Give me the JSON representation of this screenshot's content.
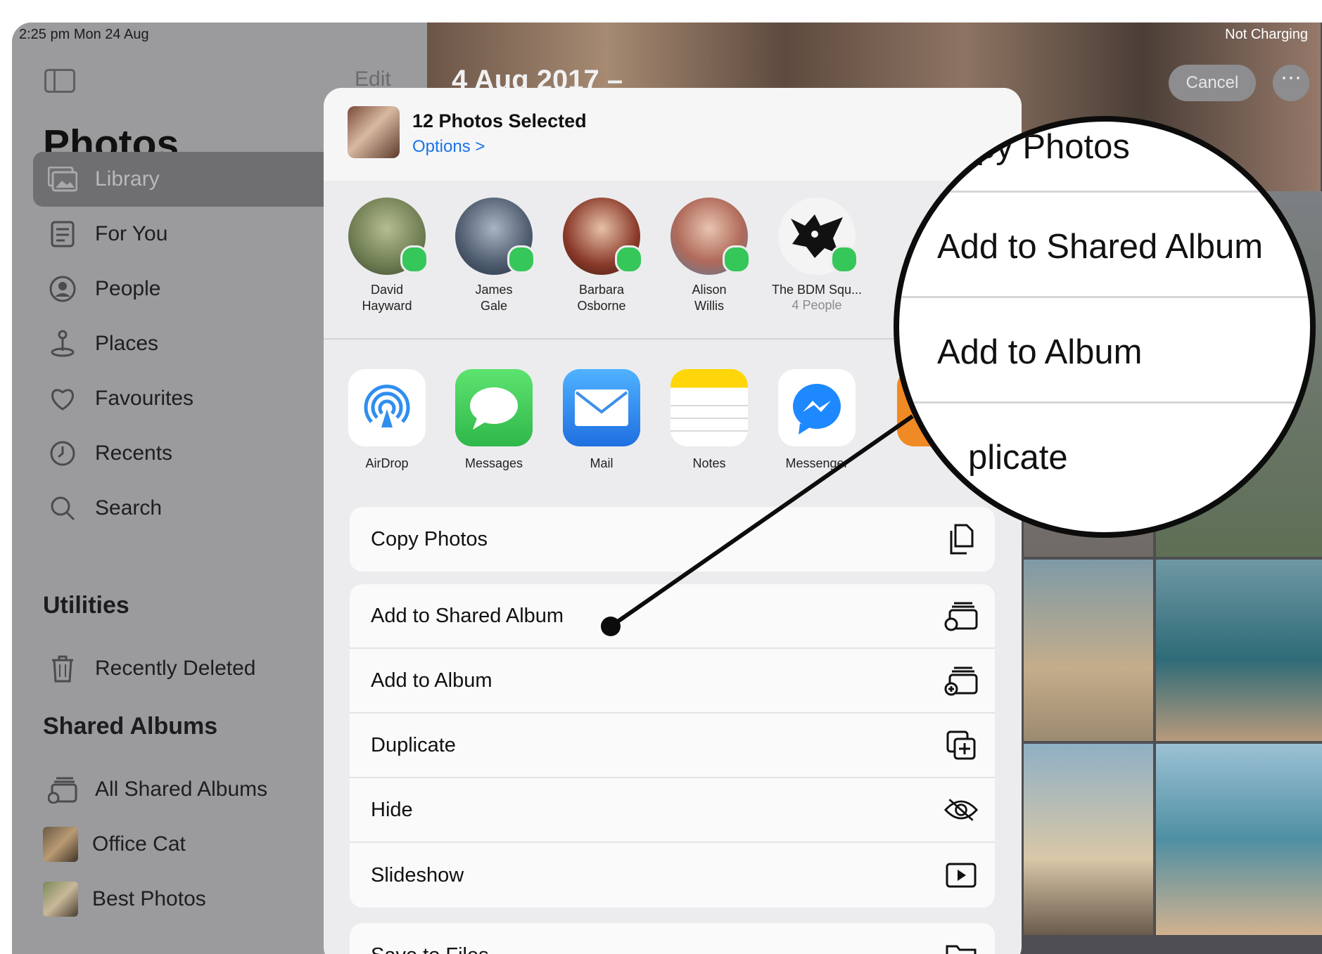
{
  "status": {
    "time": "2:25 pm  Mon 24 Aug",
    "right": "Not Charging"
  },
  "sidebar": {
    "edit_label": "Edit",
    "title": "Photos",
    "items": [
      {
        "label": "Library",
        "icon": "library-icon"
      },
      {
        "label": "For You",
        "icon": "for-you-icon"
      },
      {
        "label": "People",
        "icon": "people-icon"
      },
      {
        "label": "Places",
        "icon": "places-icon"
      },
      {
        "label": "Favourites",
        "icon": "heart-icon"
      },
      {
        "label": "Recents",
        "icon": "clock-icon"
      },
      {
        "label": "Search",
        "icon": "search-icon"
      }
    ],
    "utilities_heading": "Utilities",
    "utilities": [
      {
        "label": "Recently Deleted",
        "icon": "trash-icon"
      }
    ],
    "shared_heading": "Shared Albums",
    "shared": [
      {
        "label": "All Shared Albums",
        "icon": "shared-album-icon"
      },
      {
        "label": "Office Cat",
        "icon": "album-thumbnail"
      },
      {
        "label": "Best Photos",
        "icon": "album-thumbnail"
      }
    ]
  },
  "grid": {
    "date": "4 Aug 2017 –",
    "cancel_label": "Cancel",
    "more_label": "···"
  },
  "sheet": {
    "title": "12 Photos Selected",
    "options": "Options >",
    "contacts": [
      {
        "name1": "David",
        "name2": "Hayward",
        "color": "#6f7d52"
      },
      {
        "name1": "James",
        "name2": "Gale",
        "color": "#4d5b6e"
      },
      {
        "name1": "Barbara",
        "name2": "Osborne",
        "color": "#8a3a2a"
      },
      {
        "name1": "Alison",
        "name2": "Willis",
        "color": "#b06a5a"
      },
      {
        "name1": "The BDM Squ...",
        "name2": "4 People",
        "color": "#1a1a1a"
      }
    ],
    "apps": [
      {
        "label": "AirDrop",
        "icon": "airdrop-icon"
      },
      {
        "label": "Messages",
        "icon": "messages-icon"
      },
      {
        "label": "Mail",
        "icon": "mail-icon"
      },
      {
        "label": "Notes",
        "icon": "notes-icon"
      },
      {
        "label": "Messenger",
        "icon": "messenger-icon"
      }
    ],
    "actions_top": [
      {
        "label": "Copy Photos",
        "icon": "copy-icon"
      }
    ],
    "actions": [
      {
        "label": "Add to Shared Album",
        "icon": "shared-album-icon"
      },
      {
        "label": "Add to Album",
        "icon": "add-album-icon"
      },
      {
        "label": "Duplicate",
        "icon": "duplicate-icon"
      },
      {
        "label": "Hide",
        "icon": "hide-icon"
      },
      {
        "label": "Slideshow",
        "icon": "slideshow-icon"
      }
    ],
    "actions_bottom": [
      {
        "label": "Save to Files",
        "icon": "folder-icon"
      }
    ]
  },
  "magnifier": {
    "rows": [
      "py Photos",
      "Add to Shared Album",
      "Add to Album",
      "plicate"
    ]
  }
}
